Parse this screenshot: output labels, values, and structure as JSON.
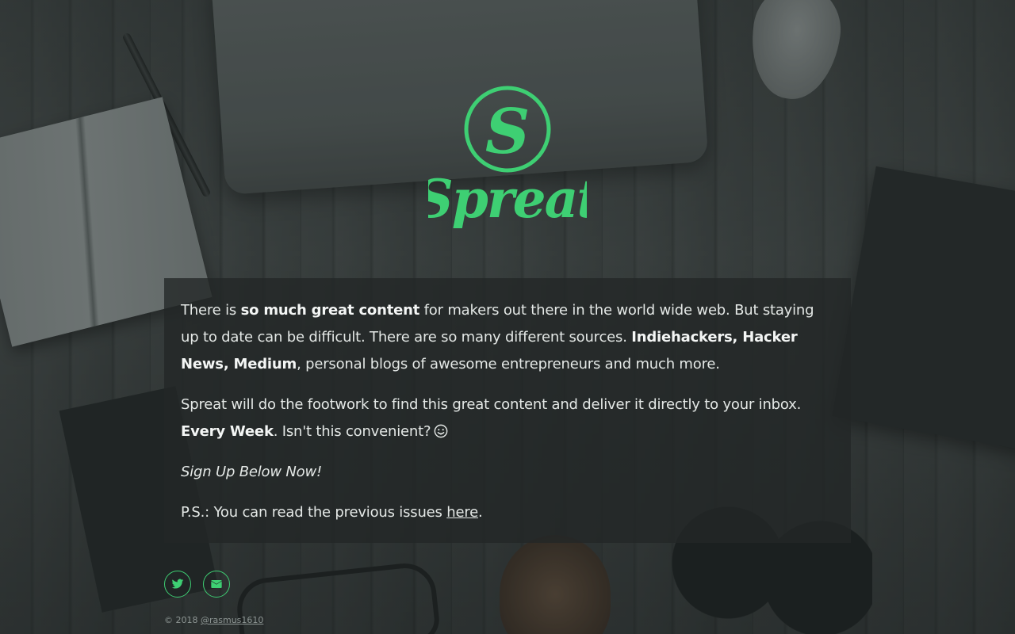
{
  "brand": {
    "logo_letter": "S",
    "name": "Spreat",
    "accent_color": "#3ecf73"
  },
  "intro": {
    "p1_a": "There is ",
    "p1_b": "so much great content",
    "p1_c": " for makers out there in the world wide web. But staying up to date can be difficult. There are so many different sources. ",
    "p1_d": "Indiehackers, Hacker News, Medium",
    "p1_e": ", personal blogs of awesome entrepreneurs and much more.",
    "p2_a": "Spreat will do the footwork to find this great content and deliver it directly to your inbox. ",
    "p2_b": "Every Week",
    "p2_c": ". Isn't this convenient?",
    "p2_emoji": "smiling-tongue-emoji",
    "p3": "Sign Up Below Now!",
    "p4_a": "P.S.: You can read the previous issues ",
    "p4_link": "here",
    "p4_c": "."
  },
  "social": {
    "twitter_icon": "twitter-icon",
    "mail_icon": "envelope-icon"
  },
  "footer": {
    "copyright": "© 2018 ",
    "author_link": "@rasmus1610"
  }
}
